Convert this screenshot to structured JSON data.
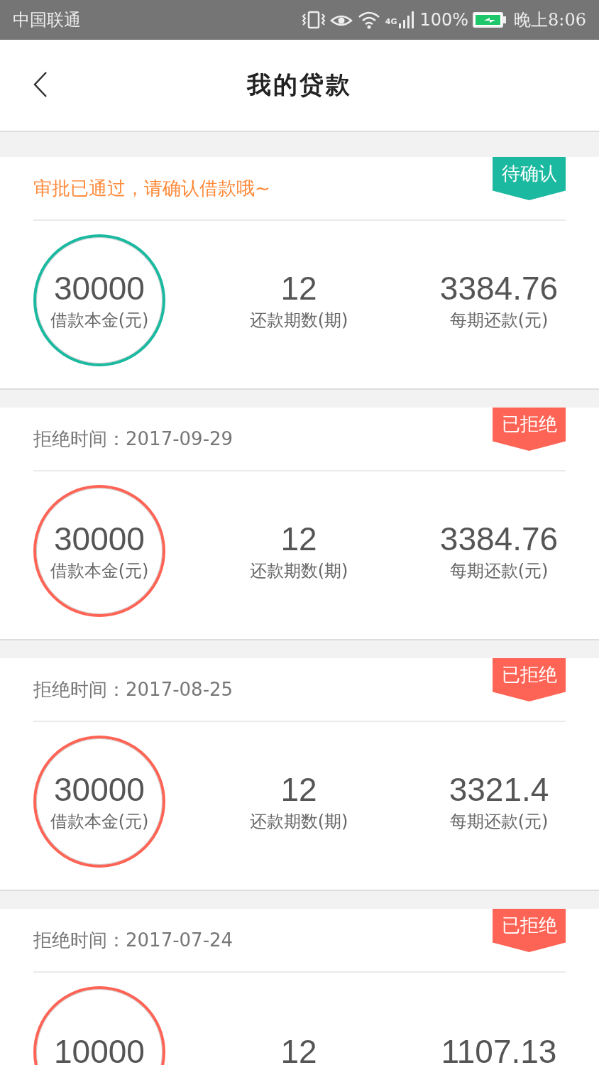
{
  "status_bar": {
    "carrier": "中国联通",
    "network": "4G",
    "battery": "100%",
    "time": "晚上8:06"
  },
  "header": {
    "title": "我的贷款"
  },
  "loans": [
    {
      "kind": "pending",
      "badge": "待确认",
      "notice": "审批已通过，请确认借款哦~",
      "stats": [
        {
          "value": "30000",
          "label": "借款本金(元)"
        },
        {
          "value": "12",
          "label": "还款期数(期)"
        },
        {
          "value": "3384.76",
          "label": "每期还款(元)"
        }
      ]
    },
    {
      "kind": "rejected",
      "badge": "已拒绝",
      "notice": "拒绝时间：2017-09-29",
      "stats": [
        {
          "value": "30000",
          "label": "借款本金(元)"
        },
        {
          "value": "12",
          "label": "还款期数(期)"
        },
        {
          "value": "3384.76",
          "label": "每期还款(元)"
        }
      ]
    },
    {
      "kind": "rejected",
      "badge": "已拒绝",
      "notice": "拒绝时间：2017-08-25",
      "stats": [
        {
          "value": "30000",
          "label": "借款本金(元)"
        },
        {
          "value": "12",
          "label": "还款期数(期)"
        },
        {
          "value": "3321.4",
          "label": "每期还款(元)"
        }
      ]
    },
    {
      "kind": "rejected",
      "badge": "已拒绝",
      "notice": "拒绝时间：2017-07-24",
      "stats": [
        {
          "value": "10000"
        },
        {
          "value": "12"
        },
        {
          "value": "1107.13"
        }
      ]
    }
  ]
}
